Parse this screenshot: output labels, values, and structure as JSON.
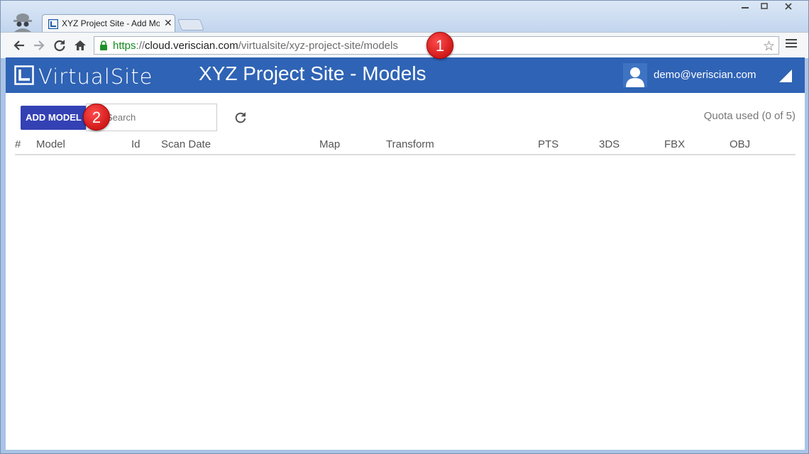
{
  "browser": {
    "tab_title": "XYZ Project Site - Add Mo",
    "tab_close": "✕",
    "url_scheme": "https",
    "url_sep": "://",
    "url_host": "cloud.veriscian.com",
    "url_path": "/virtualsite/xyz-project-site/models"
  },
  "app": {
    "logo_text": "VirtualSite",
    "page_title": "XYZ Project Site - Models",
    "user_email": "demo@veriscian.com",
    "brand_color": "#2f63b5",
    "button_color": "#3441b4"
  },
  "toolbar": {
    "add_model_label": "ADD MODEL",
    "search_placeholder": "Search",
    "quota_text": "Quota used (0 of 5)"
  },
  "table": {
    "headers": [
      "#",
      "Model",
      "Id",
      "Scan Date",
      "Map",
      "Transform",
      "PTS",
      "3DS",
      "FBX",
      "OBJ"
    ],
    "rows": []
  },
  "annotations": {
    "callout_1": "1",
    "callout_2": "2"
  }
}
